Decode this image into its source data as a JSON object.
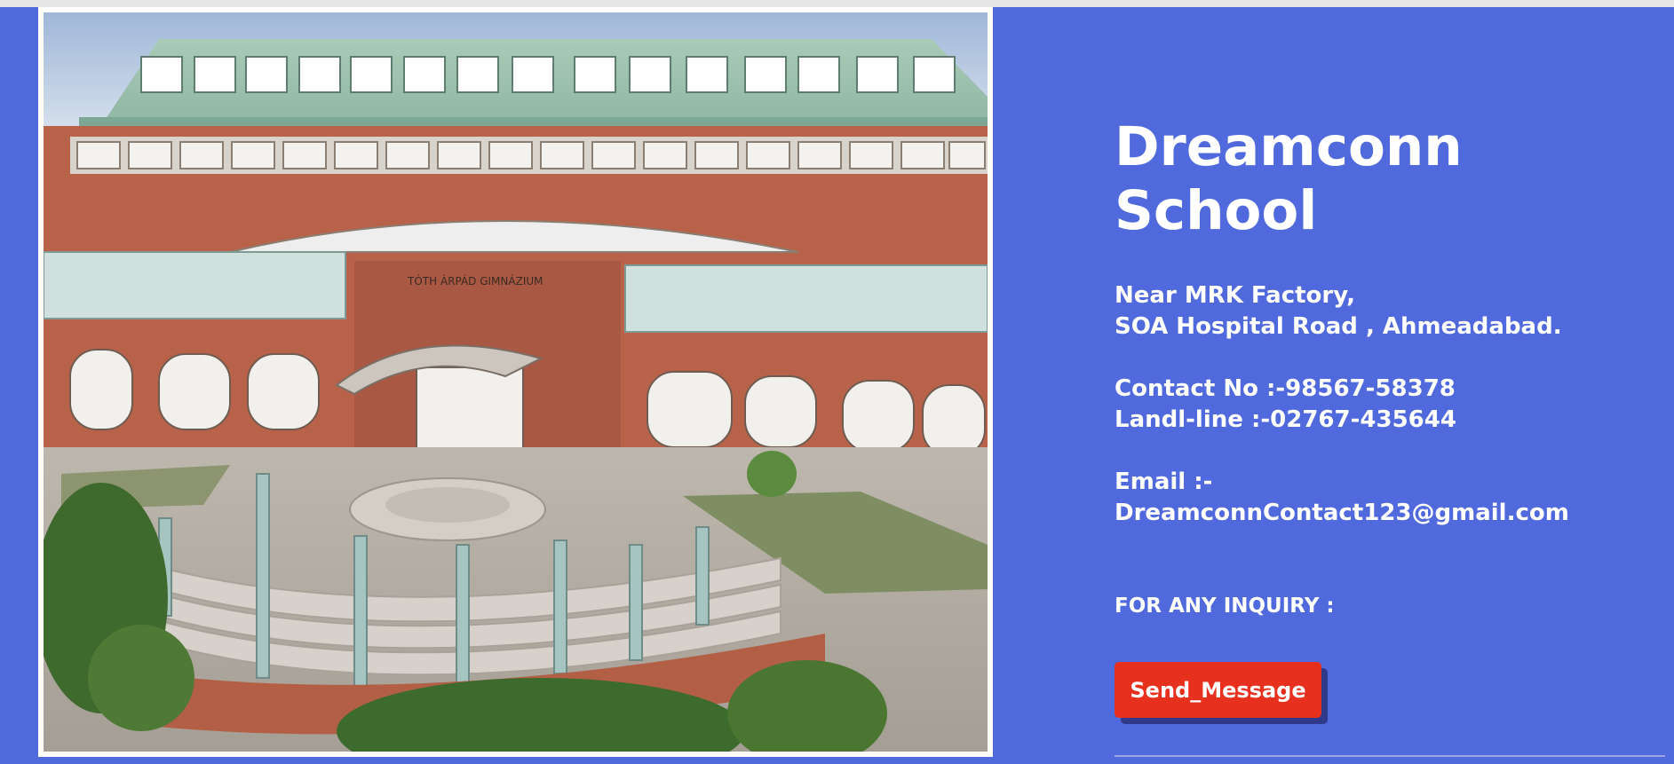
{
  "school": {
    "name_line1": "Dreamconn",
    "name_line2": "School"
  },
  "address": {
    "line1": "Near MRK Factory,",
    "line2": "SOA Hospital Road , Ahmeadabad."
  },
  "contact": {
    "phone": "Contact No :-98567-58378",
    "landline": "Landl-line :-02767-435644"
  },
  "email": {
    "label": "Email :-",
    "value": "DreamconnContact123@gmail.com"
  },
  "inquiry": {
    "heading": "FOR ANY INQUIRY :",
    "button_label": "Send_Message"
  },
  "photo": {
    "sign_text": "TÓTH ÁRPÁD GIMNÁZIUM"
  },
  "colors": {
    "background": "#5069dc",
    "button": "#e8301e",
    "button_shadow": "#2f3a8a",
    "text": "#ffffff"
  }
}
